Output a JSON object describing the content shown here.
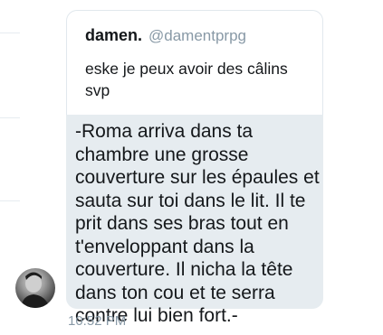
{
  "quoted_tweet": {
    "display_name": "damen.",
    "handle": "@damentprpg",
    "text": "eske je peux avoir des câlins svp"
  },
  "message": {
    "text": "-Roma arriva dans ta chambre une grosse couverture sur les épaules et sauta sur toi dans le lit. Il te prit dans ses bras tout en t'enveloppant dans la couverture. Il nicha la tête dans ton cou et te serra contre lui bien fort.-",
    "timestamp": "10:52 PM"
  },
  "colors": {
    "bubble_background": "#e6ecf0",
    "secondary_text": "#8899a6",
    "primary_text": "#14171a"
  }
}
